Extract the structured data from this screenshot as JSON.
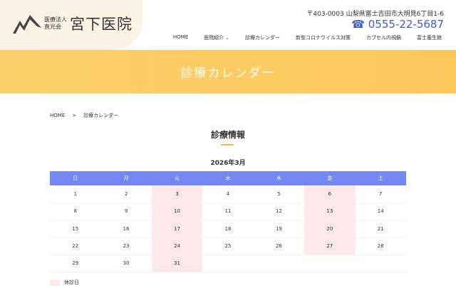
{
  "header": {
    "logo_sub1": "医療法人",
    "logo_sub2": "直光会",
    "logo_main": "宮下医院",
    "address": "〒403-0003 山梨県富士吉田市大明見6丁目1-6",
    "tel": "0555-22-5687"
  },
  "nav": [
    "HOME",
    "医院紹介",
    "診療カレンダー",
    "新型コロナウイルス対策",
    "カプセル内視鏡",
    "富士養生館"
  ],
  "banner": {
    "title": "診療カレンダー"
  },
  "breadcrumb": {
    "home": "HOME",
    "sep": ">",
    "current": "診療カレンダー"
  },
  "section_title": "診療情報",
  "calendar": {
    "month": "2026年3月",
    "weekdays": [
      "日",
      "月",
      "火",
      "水",
      "木",
      "金",
      "土"
    ],
    "weeks": [
      [
        "1",
        "2",
        "3",
        "4",
        "5",
        "6",
        "7"
      ],
      [
        "8",
        "9",
        "10",
        "11",
        "12",
        "13",
        "14"
      ],
      [
        "15",
        "16",
        "17",
        "18",
        "19",
        "20",
        "21"
      ],
      [
        "22",
        "23",
        "24",
        "25",
        "26",
        "27",
        "28"
      ],
      [
        "29",
        "30",
        "31",
        "",
        "",
        "",
        ""
      ]
    ],
    "closed_columns": [
      2,
      5
    ]
  },
  "legend": {
    "closed": "休診日"
  },
  "colors": {
    "header": "#7388f2",
    "closed": "#fde9e9",
    "banner": "#fbd06a",
    "accent": "#3b5bd0"
  }
}
